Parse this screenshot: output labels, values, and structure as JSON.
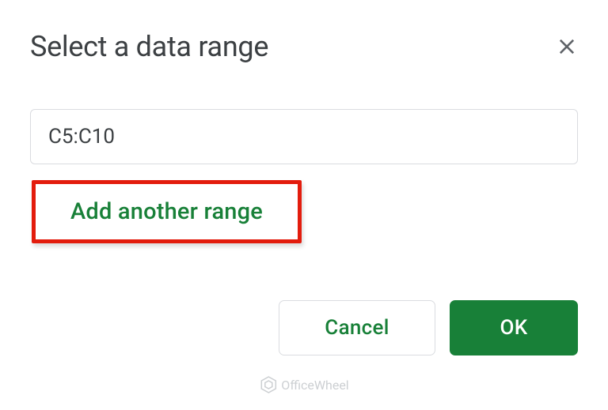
{
  "dialog": {
    "title": "Select a data range",
    "rangeValue": "C5:C10",
    "addRangeLabel": "Add another range",
    "cancelLabel": "Cancel",
    "okLabel": "OK"
  },
  "watermark": {
    "text": "OfficeWheel"
  }
}
